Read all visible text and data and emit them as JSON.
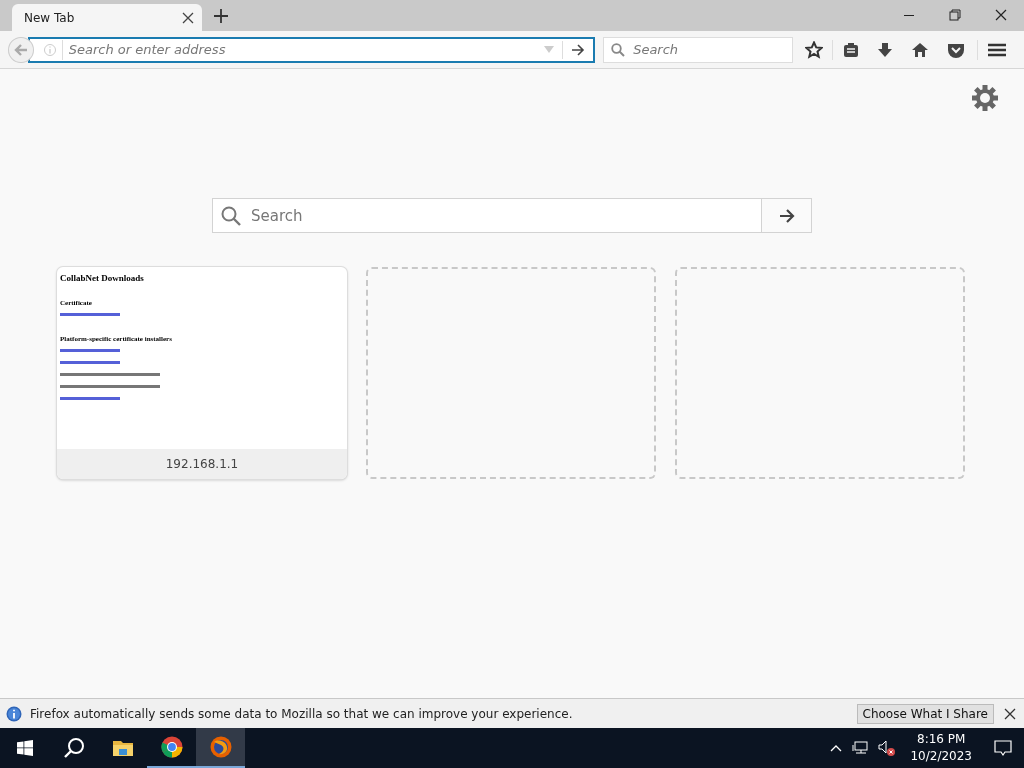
{
  "browser": {
    "tabs": [
      {
        "title": "New Tab",
        "selected": true
      }
    ],
    "address_bar": {
      "placeholder": "Search or enter address"
    },
    "search_bar": {
      "placeholder": "Search"
    }
  },
  "new_tab_page": {
    "search": {
      "placeholder": "Search"
    },
    "tiles": [
      {
        "kind": "thumbnail",
        "url": "192.168.1.1",
        "preview": {
          "title": "CollabNet Downloads",
          "sections": [
            {
              "heading": "Certificate",
              "lines": [
                {
                  "kind": "link"
                }
              ]
            },
            {
              "heading": "Platform-specific certificate installers",
              "lines": [
                {
                  "kind": "link"
                },
                {
                  "kind": "link"
                },
                {
                  "kind": "note"
                },
                {
                  "kind": "note"
                },
                {
                  "kind": "link"
                }
              ]
            }
          ]
        }
      },
      {
        "kind": "empty"
      },
      {
        "kind": "empty"
      }
    ]
  },
  "notification": {
    "message": "Firefox automatically sends some data to Mozilla so that we can improve your experience.",
    "button": "Choose What I Share"
  },
  "taskbar": {
    "apps": [
      {
        "kind": "files",
        "running": false,
        "selected": false
      },
      {
        "kind": "chrome",
        "running": true,
        "selected": false
      },
      {
        "kind": "firefox",
        "running": true,
        "selected": true
      }
    ],
    "volume_muted": true,
    "time": "8:16 PM",
    "date": "10/2/2023"
  }
}
